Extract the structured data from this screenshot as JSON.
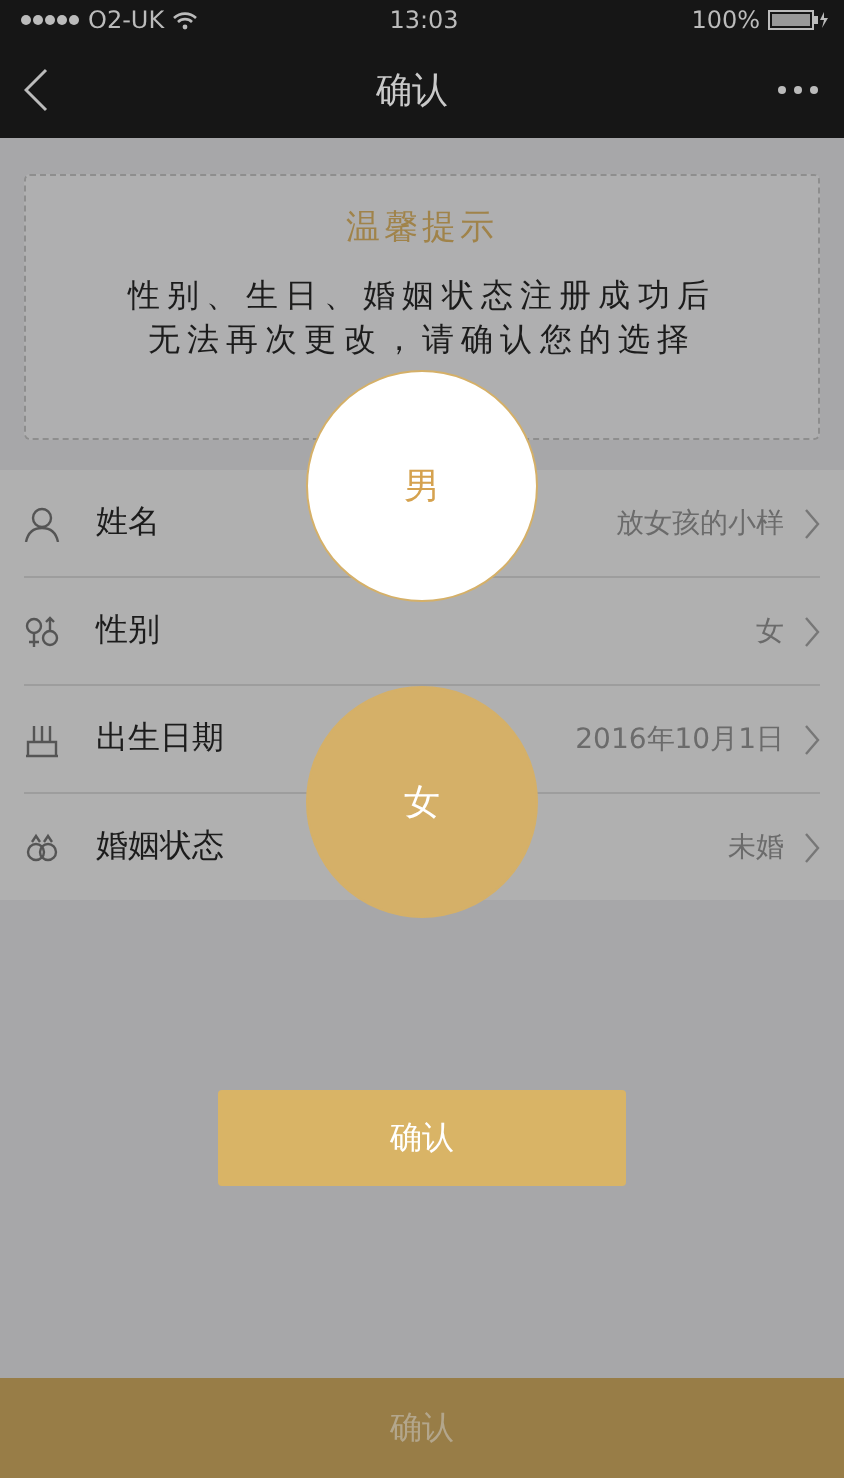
{
  "status_bar": {
    "carrier": "O2-UK",
    "time": "13:03",
    "battery": "100%"
  },
  "nav": {
    "title": "确认"
  },
  "notice": {
    "title": "温馨提示",
    "message": "性别、生日、婚姻状态注册成功后无法再次更改，请确认您的选择"
  },
  "rows": [
    {
      "kind": "person",
      "label": "姓名",
      "value": "放女孩的小样"
    },
    {
      "kind": "gender",
      "label": "性别",
      "value": "女"
    },
    {
      "kind": "birthday",
      "label": "出生日期",
      "value": "2016年10月1日"
    },
    {
      "kind": "marriage",
      "label": "婚姻状态",
      "value": "未婚"
    }
  ],
  "gender_picker": {
    "options": [
      {
        "label": "男",
        "selected": false
      },
      {
        "label": "女",
        "selected": true
      }
    ],
    "confirm": "确认"
  },
  "bottom_button": "确认"
}
